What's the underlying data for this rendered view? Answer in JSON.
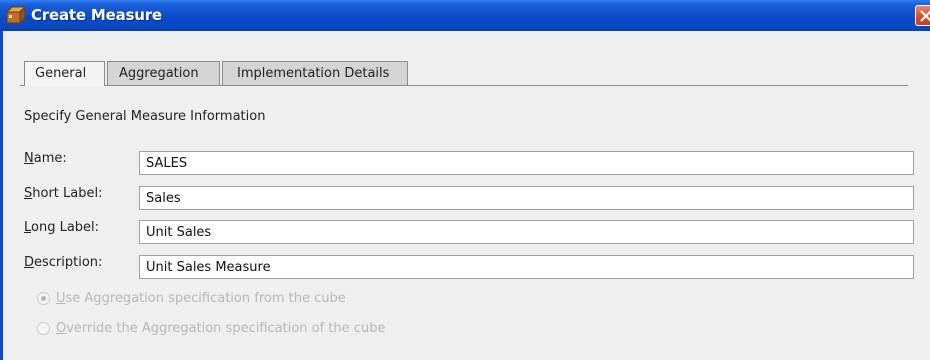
{
  "window": {
    "title": "Create Measure",
    "icon": "cube-app-icon",
    "close_icon": "close-icon"
  },
  "tabs": [
    {
      "label": "General",
      "active": true
    },
    {
      "label": "Aggregation",
      "active": false
    },
    {
      "label": "Implementation Details",
      "active": false
    }
  ],
  "general": {
    "heading": "Specify General Measure Information",
    "fields": [
      {
        "mnemonic": "N",
        "label_rest": "ame:",
        "value": "SALES"
      },
      {
        "mnemonic": "S",
        "label_rest": "hort Label:",
        "value": "Sales"
      },
      {
        "mnemonic": "L",
        "label_rest": "ong Label:",
        "value": "Unit Sales"
      },
      {
        "mnemonic": "D",
        "label_rest": "escription:",
        "value": "Unit Sales Measure"
      }
    ],
    "radios": [
      {
        "mnemonic": "U",
        "label_rest": "se Aggregation specification from the cube",
        "checked": true,
        "disabled": true
      },
      {
        "mnemonic": "O",
        "label_rest": "verride the Aggregation specification of the cube",
        "checked": false,
        "disabled": true
      }
    ]
  },
  "colors": {
    "titlebar": "#0a4bc9",
    "window_bg": "#efefef",
    "close_button": "#d8532f",
    "disabled_text": "#b8b8b8"
  }
}
